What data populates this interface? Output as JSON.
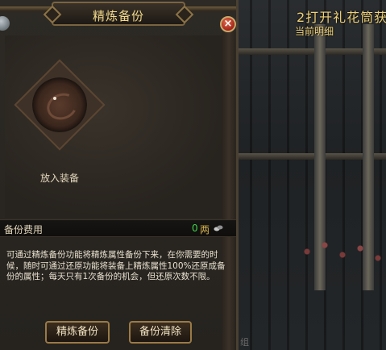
{
  "window": {
    "title": "精炼备份",
    "close_symbol": "×"
  },
  "slot": {
    "label": "放入装备"
  },
  "cost": {
    "label": "备份费用",
    "value": "0",
    "unit": "两"
  },
  "description": "可通过精炼备份功能将精炼属性备份下来，在你需要的时候，随时可通过还原功能将装备上精炼属性100%还原成备份的属性；每天只有1次备份的机会，但还原次数不限。",
  "buttons": {
    "backup": "精炼备份",
    "clear": "备份清除"
  },
  "background": {
    "caption": "2打开礼花筒获",
    "sub_caption": "当前明细",
    "bottom_text": "组"
  },
  "colors": {
    "title_gold": "#f3d98a",
    "cost_green": "#3fd24a",
    "frame_bronze": "#9a7a46"
  },
  "icons": [
    "close-icon",
    "coin-icon",
    "slot-ornament-icon"
  ]
}
